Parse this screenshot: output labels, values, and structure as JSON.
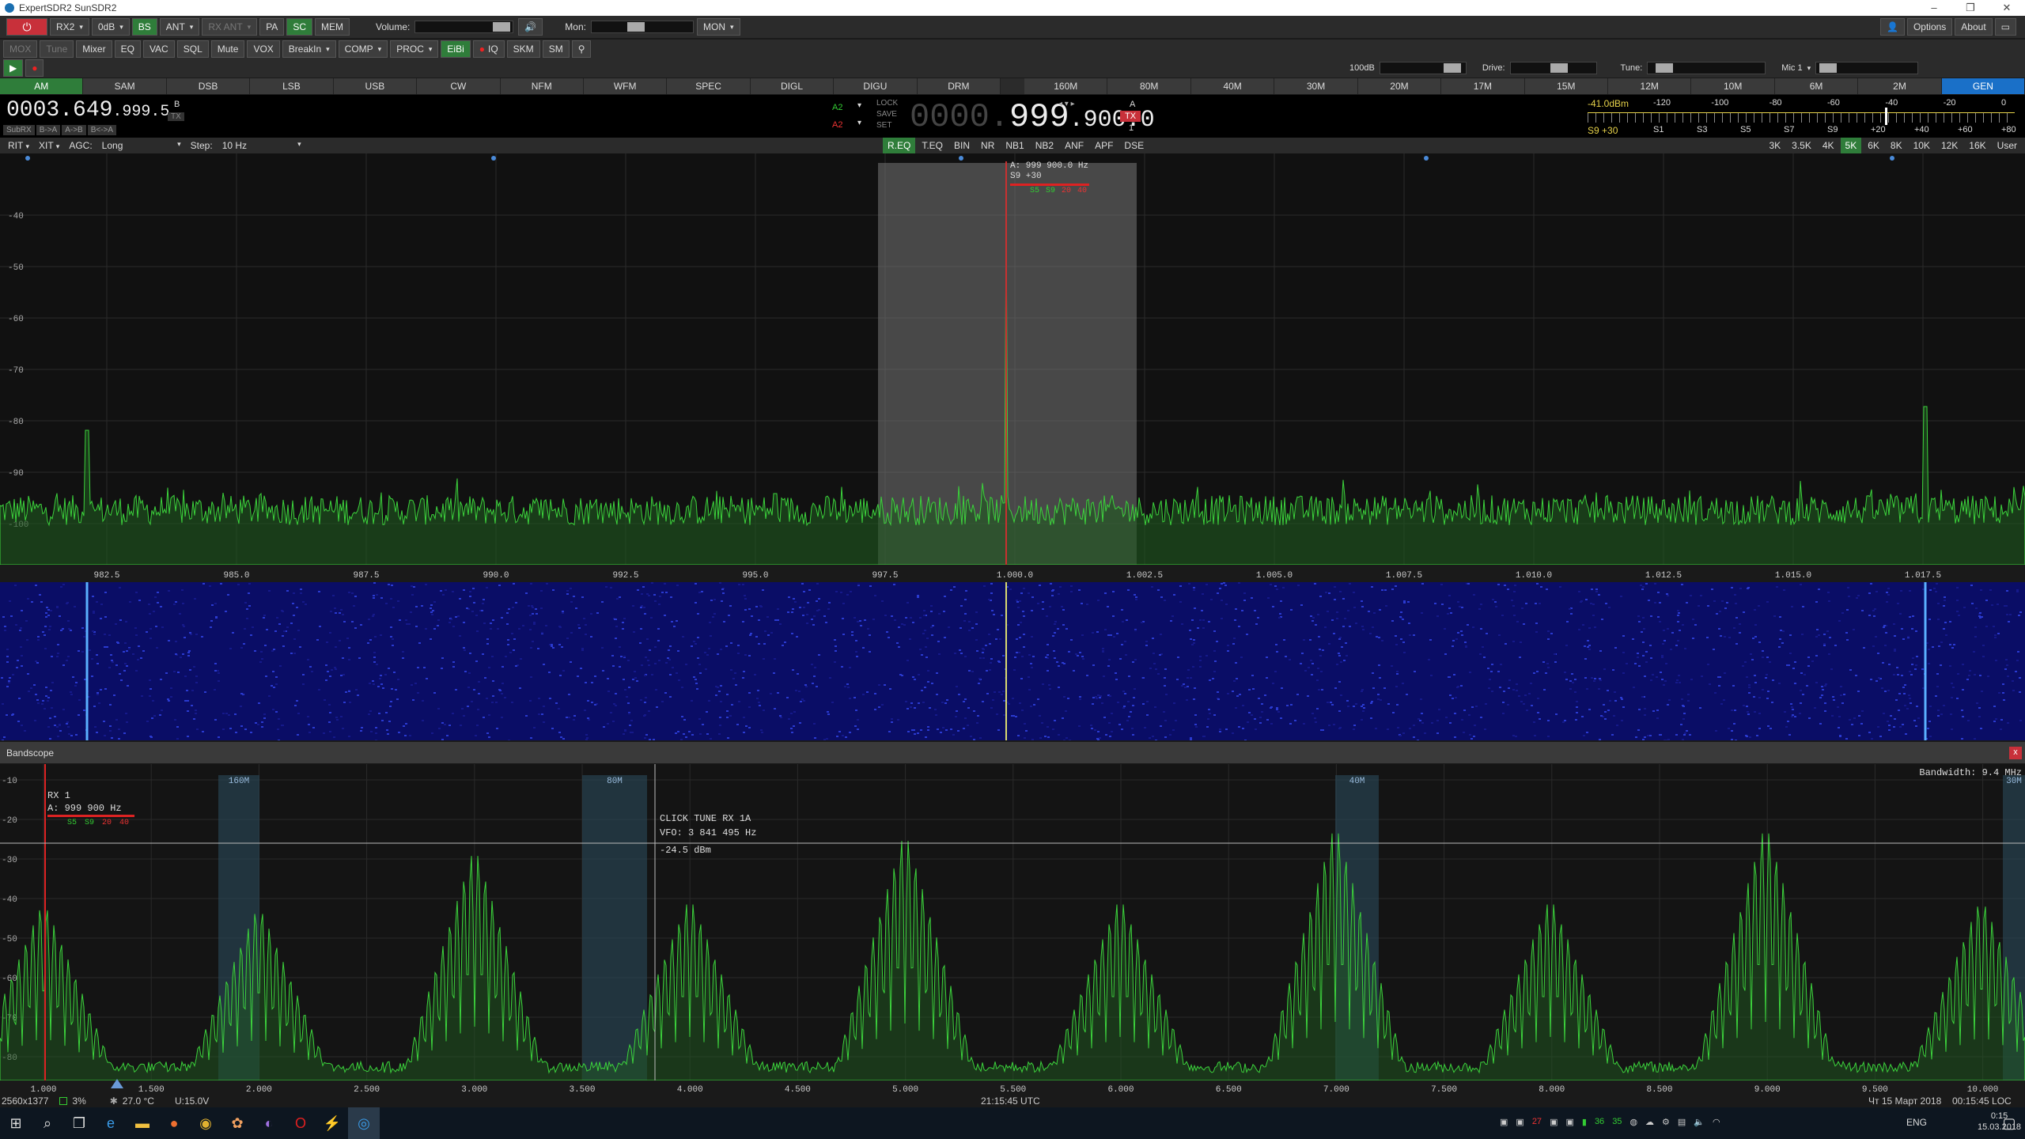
{
  "window": {
    "title": "ExpertSDR2 SunSDR2",
    "controls": [
      "–",
      "❐",
      "✕"
    ]
  },
  "toolbar1": {
    "items": [
      "RX2",
      "0dB",
      "BS",
      "ANT",
      "RX ANT",
      "PA",
      "SC",
      "MEM"
    ],
    "volume_label": "Volume:",
    "mon_label": "Mon:",
    "mon_select": "MON",
    "options_label": "Options",
    "about_label": "About"
  },
  "toolbar2": {
    "items": [
      "MOX",
      "Tune",
      "Mixer",
      "EQ",
      "VAC",
      "SQL",
      "Mute",
      "VOX",
      "BreakIn",
      "COMP",
      "PROC",
      "EiBi",
      "IQ",
      "SKM",
      "SM"
    ],
    "level_label": "100dB",
    "drive_label": "Drive:",
    "tune_label": "Tune:",
    "mic_label": "Mic 1"
  },
  "modes": [
    "AM",
    "SAM",
    "DSB",
    "LSB",
    "USB",
    "CW",
    "NFM",
    "WFM",
    "SPEC",
    "DIGL",
    "DIGU",
    "DRM"
  ],
  "bands": [
    "160M",
    "80M",
    "40M",
    "30M",
    "20M",
    "17M",
    "15M",
    "12M",
    "10M",
    "6M",
    "2M",
    "GEN"
  ],
  "vfo": {
    "sub_freq_main": "0003.649",
    "sub_freq_tail": ".999.5",
    "b_label": "B",
    "tx_label": "TX",
    "sub_buttons": [
      "SubRX",
      "B->A",
      "A->B",
      "B<->A"
    ],
    "a2_label": "A2",
    "lock": "LOCK",
    "save": "SAVE",
    "set": "SET",
    "main_dim": "0000.",
    "main_bright": "999",
    "main_tail": ".900.0",
    "a_label": "A",
    "tx_badge": "TX",
    "rx_num": "1"
  },
  "smeter": {
    "level": "-41.0dBm",
    "reading": "S9 +30",
    "top_scale": [
      "-120",
      "-100",
      "-80",
      "-60",
      "-40",
      "-20",
      "0"
    ],
    "bottom_scale": [
      "S1",
      "S3",
      "S5",
      "S7",
      "S9",
      "+20",
      "+40",
      "+60",
      "+80"
    ]
  },
  "toolbar3": {
    "rit": "RIT",
    "xit": "XIT",
    "agc_label": "AGC:",
    "agc_value": "Long",
    "step_label": "Step:",
    "step_value": "10 Hz",
    "dsp": [
      "R.EQ",
      "T.EQ",
      "BIN",
      "NR",
      "NB1",
      "NB2",
      "ANF",
      "APF",
      "DSE"
    ],
    "filters": [
      "3K",
      "3.5K",
      "4K",
      "5K",
      "6K",
      "8K",
      "10K",
      "12K",
      "16K",
      "User"
    ]
  },
  "spectrum": {
    "db_labels": [
      "-40",
      "-50",
      "-60",
      "-70",
      "-80",
      "-90",
      "-100"
    ],
    "freq_labels": [
      "982.5",
      "985.0",
      "987.5",
      "990.0",
      "992.5",
      "995.0",
      "997.5",
      "1.000.0",
      "1.002.5",
      "1.005.0",
      "1.007.5",
      "1.010.0",
      "1.012.5",
      "1.015.0",
      "1.017.5"
    ],
    "info_freq": "A: 999 900.0 Hz",
    "info_s": "S9 +30",
    "info_scale": [
      "S5",
      "S9",
      "20",
      "40"
    ]
  },
  "bandscope": {
    "title": "Bandscope",
    "close": "x",
    "bandwidth": "Bandwidth: 9.4 MHz",
    "rx_label": "RX 1",
    "rx_freq": "A: 999 900 Hz",
    "rx_scale": [
      "S5",
      "S9",
      "20",
      "40"
    ],
    "band_marks": [
      "160M",
      "80M",
      "40M",
      "30M"
    ],
    "click_tune": "CLICK TUNE RX 1A",
    "vfo_line": "VFO: 3 841 495 Hz",
    "dbm_line": "-24.5 dBm",
    "db_labels": [
      "-10",
      "-20",
      "-30",
      "-40",
      "-50",
      "-60",
      "-70",
      "-80"
    ],
    "freq_labels": [
      "1.000",
      "1.500",
      "2.000",
      "2.500",
      "3.000",
      "3.500",
      "4.000",
      "4.500",
      "5.000",
      "5.500",
      "6.000",
      "6.500",
      "7.000",
      "7.500",
      "8.000",
      "8.500",
      "9.000",
      "9.500",
      "10.000"
    ]
  },
  "status": {
    "resolution": "2560x1377",
    "cpu": "3%",
    "temp": "27.0 °C",
    "voltage": "U:15.0V",
    "utc": "21:15:45 UTC",
    "date_local": "Чт 15 Март 2018",
    "local": "00:15:45 LOC"
  },
  "taskbar": {
    "lang": "ENG",
    "time": "0:15",
    "date": "15.03.2018",
    "tray_numbers": [
      "27",
      "36",
      "35"
    ]
  }
}
